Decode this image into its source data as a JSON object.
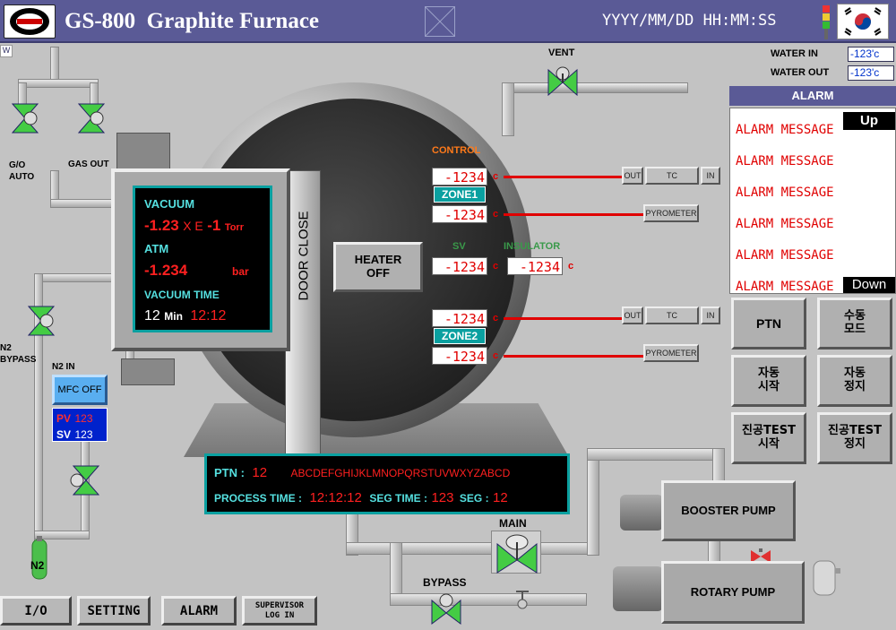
{
  "header": {
    "logo_text": "W",
    "title": "GS-800  Graphite Furnace",
    "datetime": "YYYY/MM/DD HH:MM:SS",
    "corner_tag": "W"
  },
  "water": {
    "in_label": "WATER IN",
    "in_value": "-123'c",
    "out_label": "WATER OUT",
    "out_value": "-123'c"
  },
  "valves": {
    "vent": "VENT",
    "go_auto": "G/O\nAUTO",
    "gas_out": "GAS OUT",
    "n2_bypass": "N2\nBYPASS",
    "n2_in": "N2 IN",
    "main": "MAIN",
    "bypass": "BYPASS",
    "n2_tank": "N2"
  },
  "mfc": {
    "button": "MFC OFF",
    "pv_label": "PV",
    "pv_value": "123",
    "sv_label": "SV",
    "sv_value": "123"
  },
  "vacuum_panel": {
    "vacuum_label": "VACUUM",
    "vacuum_mantissa": "-1.23",
    "vacuum_x": "X E",
    "vacuum_exp": "-1",
    "vacuum_unit": "Torr",
    "atm_label": "ATM",
    "atm_value": "-1.234",
    "atm_unit": "bar",
    "vt_label": "VACUUM TIME",
    "vt_min": "12",
    "vt_min_unit": "Min",
    "vt_clock": "12:12"
  },
  "door": {
    "label": "DOOR CLOSE"
  },
  "heater": {
    "label": "HEATER\nOFF"
  },
  "control": {
    "title": "CONTROL",
    "sv_label": "SV",
    "insulator_label": "INSULATOR",
    "unit": "c",
    "zone1": {
      "name": "ZONE1",
      "pv": "-1234",
      "lower": "-1234",
      "sv": "-1234",
      "insulator": "-1234"
    },
    "zone2": {
      "name": "ZONE2",
      "pv": "-1234",
      "lower": "-1234"
    },
    "tc_out": "OUT",
    "tc": "TC",
    "tc_in": "IN",
    "pyrometer": "PYROMETER"
  },
  "process": {
    "ptn_label": "PTN :",
    "ptn_value": "12",
    "ptn_name": "ABCDEFGHIJKLMNOPQRSTUVWXYZABCD",
    "pt_label": "PROCESS TIME :",
    "pt_value": "12:12:12",
    "seg_time_label": "SEG TIME :",
    "seg_time_value": "123",
    "seg_label": "SEG :",
    "seg_value": "12"
  },
  "pumps": {
    "booster": "BOOSTER PUMP",
    "rotary": "ROTARY PUMP"
  },
  "alarm": {
    "title": "ALARM",
    "up": "Up",
    "down": "Down",
    "messages": [
      "ALARM MESSAGE",
      "ALARM MESSAGE",
      "ALARM MESSAGE",
      "ALARM MESSAGE",
      "ALARM MESSAGE",
      "ALARM MESSAGE"
    ]
  },
  "controls": {
    "ptn": "PTN",
    "manual_mode": "수동\n모드",
    "auto_start": "자동\n시작",
    "auto_stop": "자동\n정지",
    "vac_test_start": "진공TEST\n시작",
    "vac_test_stop": "진공TEST\n정지"
  },
  "nav": {
    "io": "I/O",
    "setting": "SETTING",
    "alarm": "ALARM",
    "supervisor": "SUPERVISOR\nLOG IN"
  },
  "colors": {
    "title_bar": "#5a5a96",
    "alarm_header": "#5a5a96",
    "value_red": "#e00000",
    "display_cyan": "#55e0e0",
    "zone_teal": "#0aa0a0",
    "valve_green": "#44cc44"
  }
}
